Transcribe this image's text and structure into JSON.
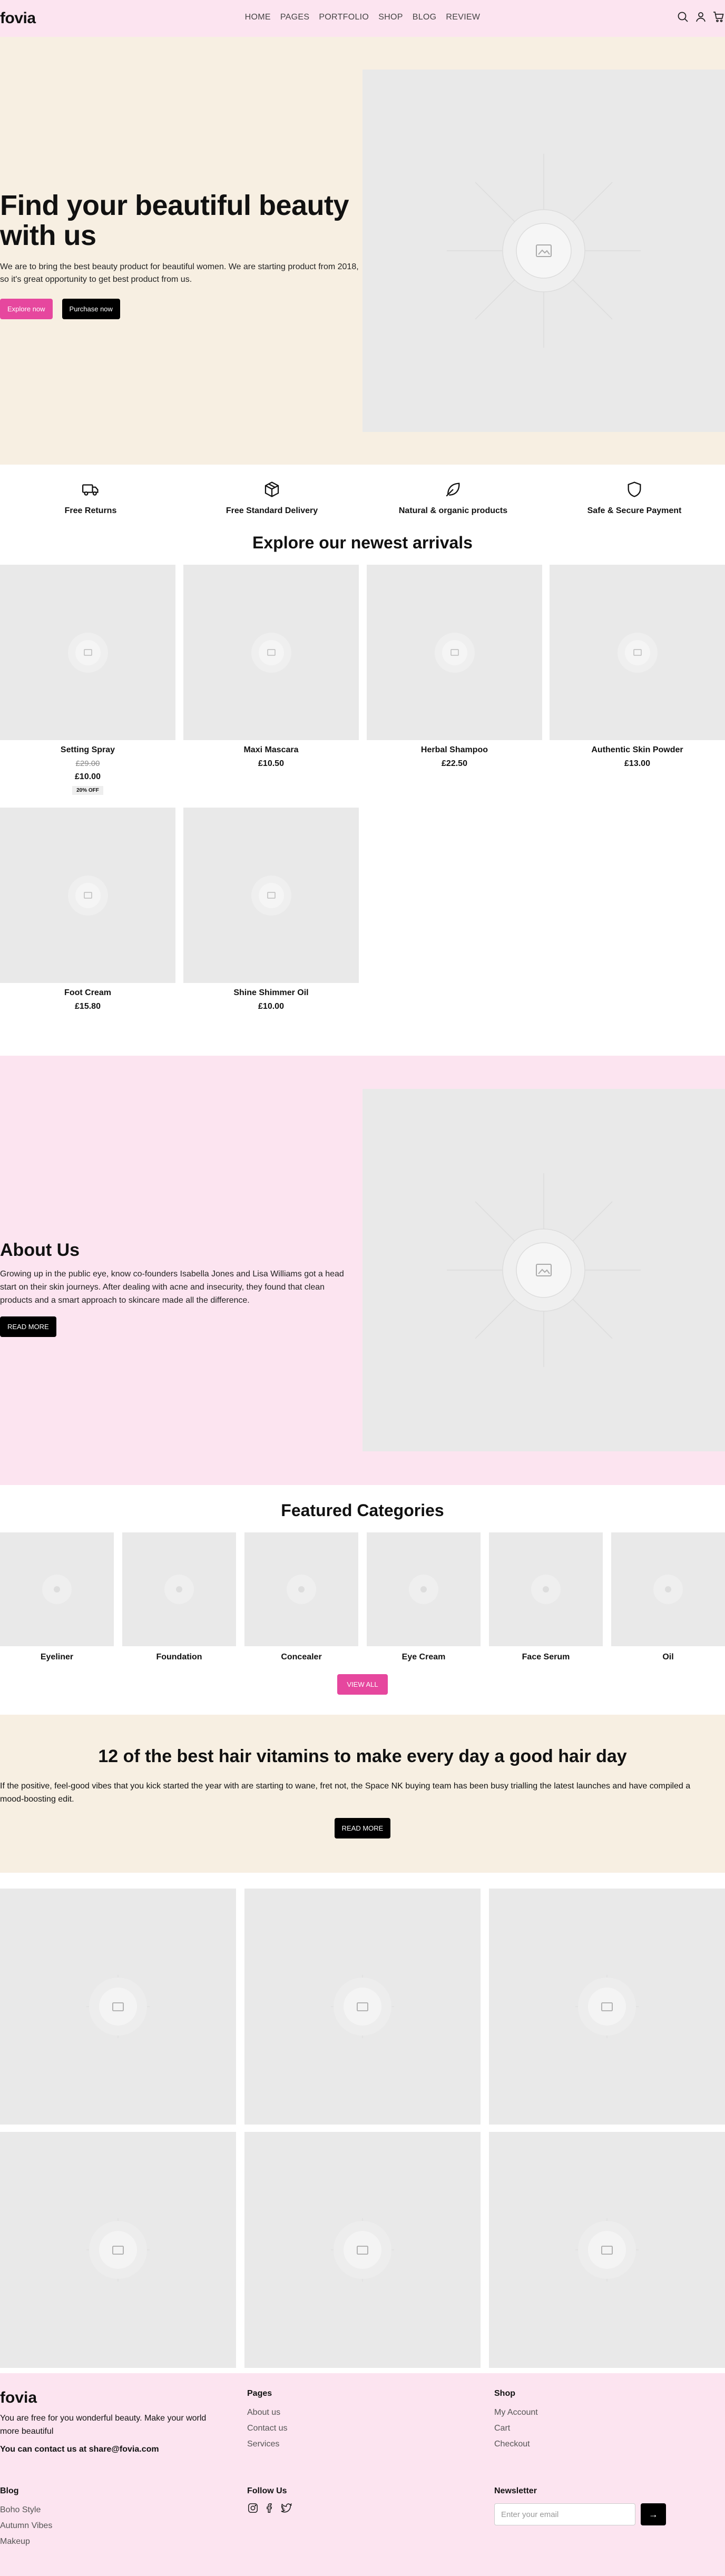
{
  "header": {
    "logo": "fovia",
    "nav": [
      "HOME",
      "PAGES",
      "PORTFOLIO",
      "SHOP",
      "BLOG",
      "REVIEW"
    ],
    "icons": [
      "search-icon",
      "user-icon",
      "cart-icon"
    ]
  },
  "hero": {
    "title": "Find your beautiful beauty with us",
    "description": "We are to bring the best beauty product for beautiful women. We are starting product from 2018, so it's great opportunity to get best product from us.",
    "primary_button": "Explore now",
    "secondary_button": "Purchase now"
  },
  "features": [
    {
      "label": "Free Returns",
      "icon": "truck-icon"
    },
    {
      "label": "Free Standard Delivery",
      "icon": "box-icon"
    },
    {
      "label": "Natural & organic products",
      "icon": "leaf-icon"
    },
    {
      "label": "Safe & Secure Payment",
      "icon": "shield-icon"
    }
  ],
  "arrivals": {
    "title": "Explore our newest arrivals",
    "products": [
      {
        "name": "Setting Spray",
        "old_price": "£29.00",
        "price": "£10.00",
        "badge": "20% OFF"
      },
      {
        "name": "Maxi Mascara",
        "price": "£10.50"
      },
      {
        "name": "Herbal Shampoo",
        "price": "£22.50"
      },
      {
        "name": "Authentic Skin Powder",
        "price": "£13.00"
      },
      {
        "name": "Foot Cream",
        "price": "£15.80"
      },
      {
        "name": "Shine Shimmer Oil",
        "price": "£10.00"
      }
    ]
  },
  "about": {
    "title": "About Us",
    "description": "Growing up in the public eye, know co-founders Isabella Jones and Lisa Williams got a head start on their skin journeys. After dealing with acne and insecurity, they found that clean products and a smart approach to skincare made all the difference.",
    "button": "READ MORE"
  },
  "categories": {
    "title": "Featured Categories",
    "items": [
      "Eyeliner",
      "Foundation",
      "Concealer",
      "Eye Cream",
      "Face Serum",
      "Oil"
    ],
    "button": "VIEW ALL"
  },
  "vitamins": {
    "title": "12 of the best hair vitamins to make every day a good hair day",
    "description": "If the positive, feel-good vibes that you kick started the year with are starting to wane, fret not, the Space NK buying team has been busy trialling the latest launches and have compiled a mood-boosting edit.",
    "button": "READ MORE"
  },
  "footer": {
    "logo": "fovia",
    "tagline": "You are free for you wonderful beauty. Make your world more beautiful",
    "contact": "You can contact us at share@fovia.com",
    "pages": {
      "heading": "Pages",
      "links": [
        "About us",
        "Contact us",
        "Services"
      ]
    },
    "shop": {
      "heading": "Shop",
      "links": [
        "My Account",
        "Cart",
        "Checkout"
      ]
    },
    "blog": {
      "heading": "Blog",
      "links": [
        "Boho Style",
        "Autumn Vibes",
        "Makeup"
      ]
    },
    "follow": {
      "heading": "Follow Us",
      "icons": [
        "instagram-icon",
        "facebook-icon",
        "twitter-icon"
      ]
    },
    "newsletter": {
      "heading": "Newsletter",
      "placeholder": "Enter your email",
      "button": "→"
    }
  },
  "colors": {
    "pink_bg": "#fce4f0",
    "cream_bg": "#f7efe2",
    "accent": "#e6479e",
    "placeholder": "#e9e9e9"
  }
}
